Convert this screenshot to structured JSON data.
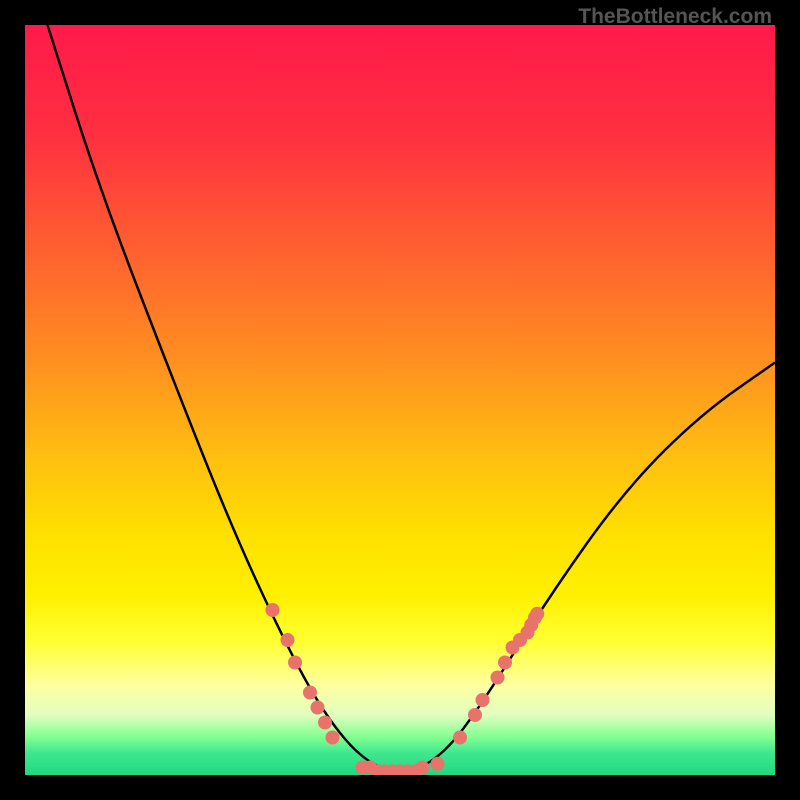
{
  "watermark": "TheBottleneck.com",
  "chart_data": {
    "type": "line",
    "title": "",
    "xlabel": "",
    "ylabel": "",
    "ylim": [
      0,
      100
    ],
    "xlim": [
      0,
      100
    ],
    "description": "Bottleneck percentage curve; V-shape with minimum near center. No visible axis ticks or numeric labels.",
    "curve_points": [
      {
        "x": 3,
        "y": 100
      },
      {
        "x": 10,
        "y": 78
      },
      {
        "x": 20,
        "y": 52
      },
      {
        "x": 28,
        "y": 32
      },
      {
        "x": 35,
        "y": 17
      },
      {
        "x": 40,
        "y": 8
      },
      {
        "x": 45,
        "y": 2
      },
      {
        "x": 50,
        "y": 0
      },
      {
        "x": 55,
        "y": 2
      },
      {
        "x": 60,
        "y": 8
      },
      {
        "x": 70,
        "y": 24
      },
      {
        "x": 80,
        "y": 38
      },
      {
        "x": 90,
        "y": 48
      },
      {
        "x": 100,
        "y": 55
      }
    ],
    "marker_points": [
      {
        "x": 33,
        "y": 22
      },
      {
        "x": 35,
        "y": 18
      },
      {
        "x": 36,
        "y": 15
      },
      {
        "x": 38,
        "y": 11
      },
      {
        "x": 39,
        "y": 9
      },
      {
        "x": 40,
        "y": 7
      },
      {
        "x": 41,
        "y": 5
      },
      {
        "x": 45,
        "y": 1
      },
      {
        "x": 46,
        "y": 1
      },
      {
        "x": 47,
        "y": 0.5
      },
      {
        "x": 48,
        "y": 0.5
      },
      {
        "x": 49,
        "y": 0.5
      },
      {
        "x": 50,
        "y": 0.5
      },
      {
        "x": 51,
        "y": 0.5
      },
      {
        "x": 52,
        "y": 0.5
      },
      {
        "x": 53,
        "y": 1
      },
      {
        "x": 55,
        "y": 1.5
      },
      {
        "x": 58,
        "y": 5
      },
      {
        "x": 60,
        "y": 8
      },
      {
        "x": 61,
        "y": 10
      },
      {
        "x": 63,
        "y": 13
      },
      {
        "x": 64,
        "y": 15
      },
      {
        "x": 65,
        "y": 17
      },
      {
        "x": 66,
        "y": 18
      },
      {
        "x": 67,
        "y": 19
      },
      {
        "x": 67.5,
        "y": 20
      },
      {
        "x": 68,
        "y": 21
      },
      {
        "x": 68.3,
        "y": 21.5
      }
    ],
    "gradient_stops": [
      {
        "offset": 0,
        "color": "#ff1a4a"
      },
      {
        "offset": 15,
        "color": "#ff3040"
      },
      {
        "offset": 30,
        "color": "#ff6030"
      },
      {
        "offset": 45,
        "color": "#ff9020"
      },
      {
        "offset": 58,
        "color": "#ffc010"
      },
      {
        "offset": 68,
        "color": "#ffe000"
      },
      {
        "offset": 76,
        "color": "#fff000"
      },
      {
        "offset": 82,
        "color": "#ffff30"
      },
      {
        "offset": 88,
        "color": "#ffffa0"
      },
      {
        "offset": 92,
        "color": "#e0ffc0"
      },
      {
        "offset": 95,
        "color": "#80ff90"
      },
      {
        "offset": 97,
        "color": "#40e890"
      },
      {
        "offset": 100,
        "color": "#20d880"
      }
    ],
    "marker_color": "#e8736b",
    "curve_color": "#000000"
  }
}
